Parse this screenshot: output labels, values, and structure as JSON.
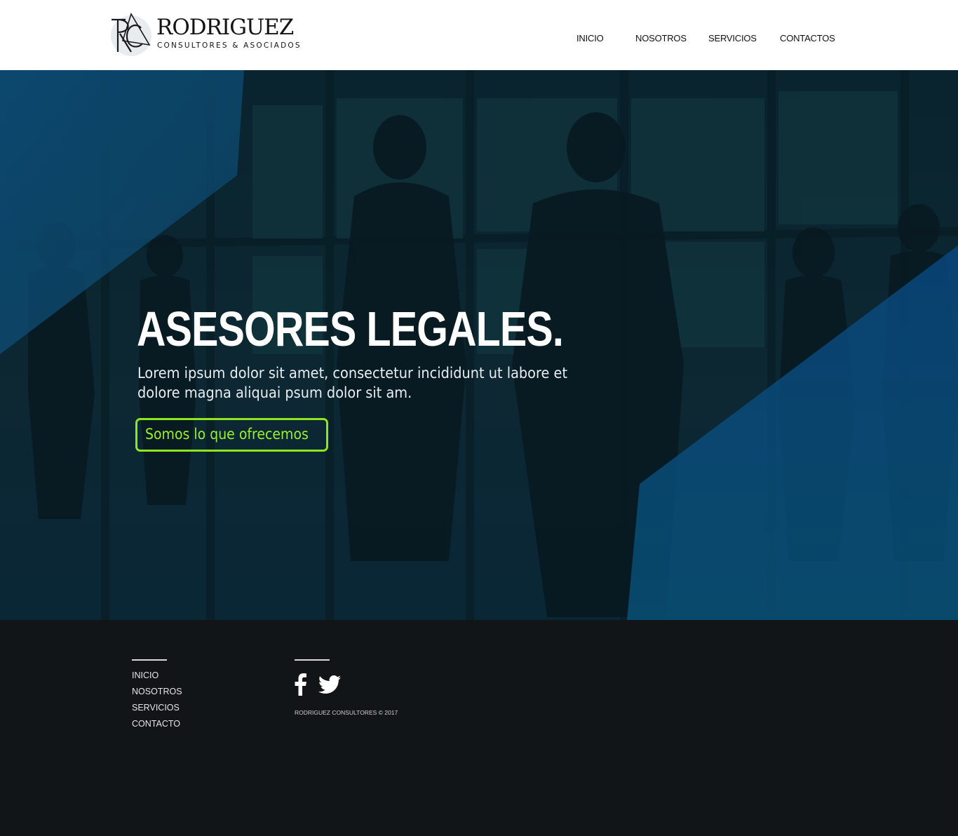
{
  "brand": {
    "monogram": "RC",
    "name": "RODRIGUEZ",
    "subtitle": "CONSULTORES & ASOCIADOS"
  },
  "nav": {
    "items": [
      "INICIO",
      "NOSOTROS",
      "SERVICIOS",
      "CONTACTOS"
    ]
  },
  "hero": {
    "title": "ASESORES LEGALES.",
    "text": "Lorem ipsum dolor sit amet, consectetur incididunt ut labore et dolore magna aliquai psum dolor sit am.",
    "cta_label": "Somos lo que ofrecemos"
  },
  "footer": {
    "links": [
      "INICIO",
      "NOSOTROS",
      "SERVICIOS",
      "CONTACTO"
    ],
    "social": [
      "facebook-icon",
      "twitter-icon"
    ],
    "copyright": "RODRIGUEZ CONSULTORES © 2017"
  },
  "colors": {
    "header_bg": "#ffffff",
    "hero_dark": "#0b2430",
    "hero_blue": "#0a4f8f",
    "accent_green": "#8ee61c",
    "footer_bg": "#111517"
  }
}
